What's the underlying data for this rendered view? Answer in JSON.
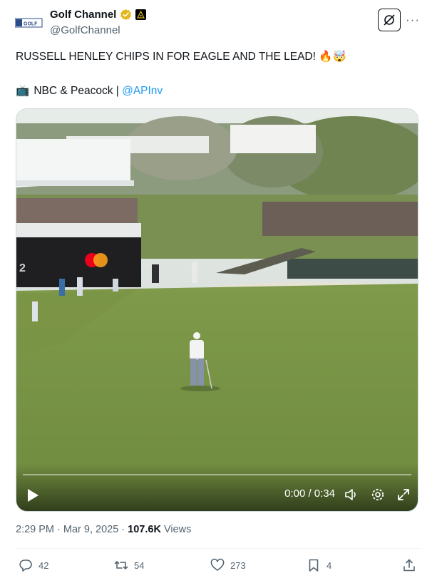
{
  "author": {
    "display_name": "Golf Channel",
    "handle": "@GolfChannel",
    "avatar_text": "GOLF"
  },
  "tweet": {
    "text": "RUSSELL HENLEY CHIPS IN FOR EAGLE AND THE LEAD! 🔥🤯",
    "line2_prefix": "NBC & Peacock | ",
    "mention": "@APInv",
    "tv_emoji": "📺"
  },
  "video": {
    "time_display": "0:00 / 0:34",
    "progress": 0,
    "billboard_text": "2"
  },
  "meta": {
    "timestamp": "2:29 PM · Mar 9, 2025",
    "separator": " · ",
    "views_count": "107.6K",
    "views_label": " Views"
  },
  "actions": {
    "replies": "42",
    "reposts": "54",
    "likes": "273",
    "bookmarks": "4"
  },
  "colors": {
    "link": "#1d9bf0",
    "secondary_text": "#536471",
    "verified_gold": "#e2b719"
  },
  "icons": [
    "verified-badge-icon",
    "affiliate-badge-icon",
    "grok-icon",
    "more-icon",
    "play-icon",
    "volume-icon",
    "settings-icon",
    "fullscreen-icon",
    "reply-icon",
    "repost-icon",
    "like-icon",
    "bookmark-icon",
    "share-icon"
  ]
}
